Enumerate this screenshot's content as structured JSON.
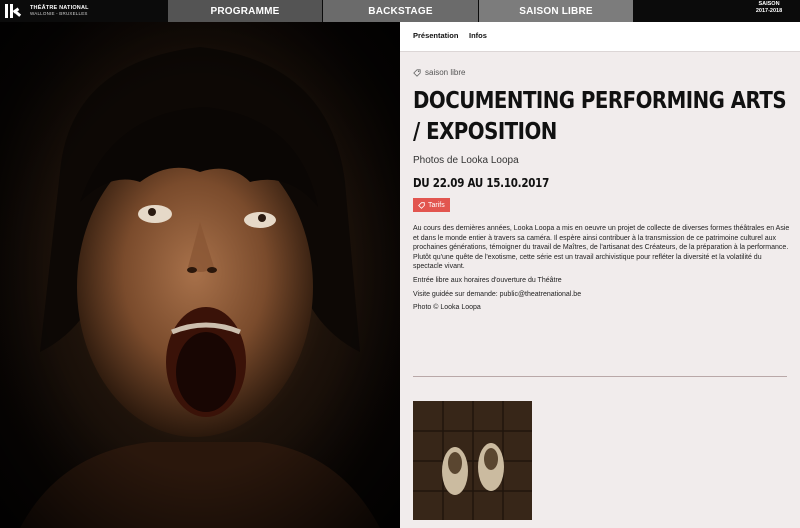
{
  "header": {
    "logo_title": "THÉÂTRE NATIONAL",
    "logo_subtitle": "WALLONIE - BRUXELLES",
    "nav": [
      {
        "label": "PROGRAMME"
      },
      {
        "label": "BACKSTAGE"
      },
      {
        "label": "SAISON LIBRE"
      }
    ],
    "season_label": "SAISON",
    "season_years": "2017-2018"
  },
  "subnav": {
    "tabs": [
      {
        "label": "Présentation"
      },
      {
        "label": "Infos"
      }
    ]
  },
  "event": {
    "tag": "saison libre",
    "title": "DOCUMENTING PERFORMING ARTS / EXPOSITION",
    "subtitle": "Photos de Looka Loopa",
    "dates": "DU 22.09 AU 15.10.2017",
    "tarifs_label": "Tarifs",
    "description": "Au cours des dernières années, Looka Loopa a mis en oeuvre un projet de collecte de diverses formes théâtrales en Asie et dans le monde entier à travers sa caméra. Il espère ainsi contribuer à la transmission de ce patrimoine culturel aux prochaines générations, témoigner du travail de Maîtres, de l'artisanat des Créateurs, de la préparation à la performance. Plutôt qu'une quête de l'exotisme, cette série est un travail archivistique pour refléter la diversité et la volatilité du spectacle vivant.",
    "entry": "Entrée libre aux horaires d'ouverture du Théâtre",
    "visit": "Visite guidée sur demande: public@theatrenational.be",
    "credit": "Photo © Looka Loopa"
  },
  "colors": {
    "accent": "#e2554f",
    "panel_bg": "#f1ecec",
    "nav_programme": "#545454",
    "nav_backstage": "#6b6b6b",
    "nav_saison": "#7c7c7c"
  },
  "icons": {
    "tag": "tag-icon",
    "tarifs": "tag-icon"
  }
}
